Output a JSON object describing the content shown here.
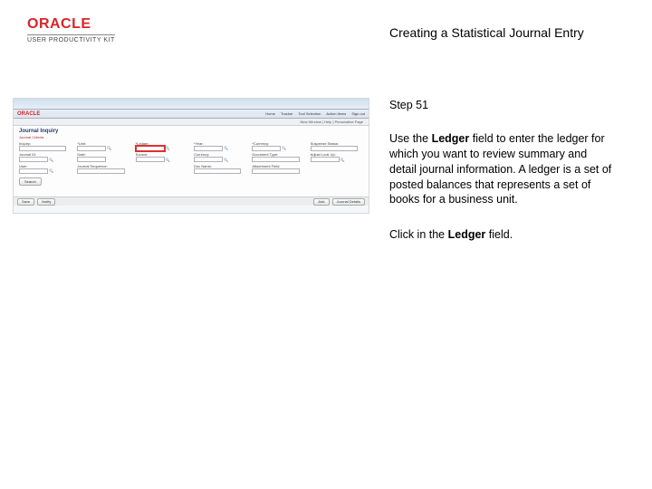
{
  "brand": {
    "name": "ORACLE",
    "product_line": "USER PRODUCTIVITY KIT"
  },
  "page_title": "Creating a Statistical Journal Entry",
  "instruction": {
    "step": "Step 51",
    "body_prefix": "Use the ",
    "body_bold1": "Ledger",
    "body_after1": " field to enter the ledger for which you want to review summary and detail journal information. A ledger is a set of posted balances that represents a set of books for a business unit.",
    "action_prefix": "Click in the ",
    "action_bold": "Ledger",
    "action_suffix": " field."
  },
  "screenshot": {
    "oracle": "ORACLE",
    "menu_items": [
      "Home",
      "Tracker",
      "Tool Selection",
      "Action Items",
      "Sign out"
    ],
    "subnav": "New Window  |  Help  |  Personalize Page",
    "heading": "Journal Inquiry",
    "subheading": "Journal Criteria",
    "fields": {
      "r1c1": "Inquiry:",
      "r1c2": "*Unit:",
      "r1c3": "*Ledger:",
      "r1c4": "*Year:",
      "r1c5": "*Currency:",
      "r1c6": "Suspense Status:",
      "r2c1": "Journal ID:",
      "r2c2": "Date:",
      "r2c3": "Source:",
      "r2c4": "Currency:",
      "r2c5": "Document Type:",
      "r2c6": "Adjust Look Up:",
      "r3c1": "User:",
      "r3c2": "Journal Sequence:",
      "r3c4": "Doc Name:",
      "r3c5": "Attachment Field:"
    },
    "search_btn": "Search",
    "footer": {
      "left1": "Save",
      "left2": "Notify",
      "right1": "Add",
      "right2": "Journal Details"
    }
  }
}
